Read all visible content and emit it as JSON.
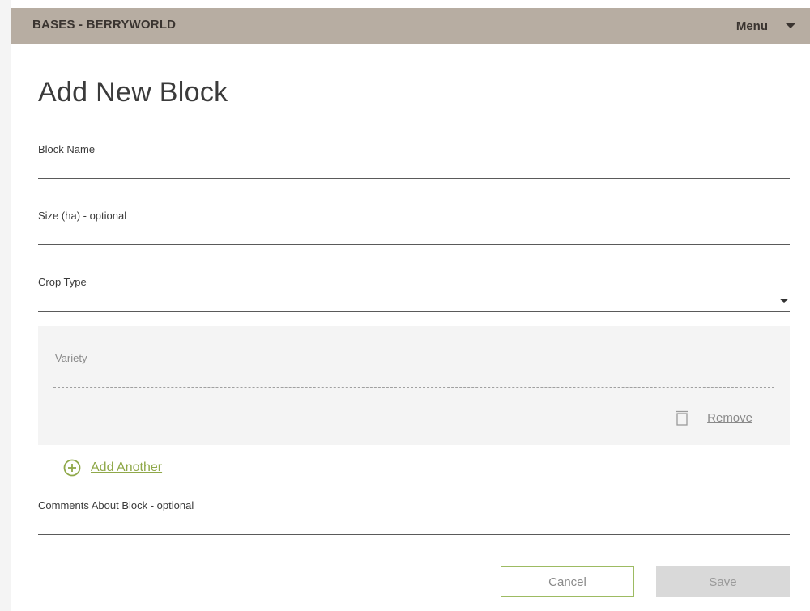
{
  "header": {
    "app_title": "BASES - BERRYWORLD",
    "menu_label": "Menu"
  },
  "page": {
    "title": "Add New Block"
  },
  "form": {
    "block_name": {
      "label": "Block Name",
      "value": ""
    },
    "size": {
      "label": "Size (ha) - optional",
      "value": ""
    },
    "crop_type": {
      "label": "Crop Type",
      "value": ""
    },
    "variety": {
      "label": "Variety",
      "value": "",
      "remove_label": "Remove"
    },
    "add_another_label": "Add Another",
    "comments": {
      "label": "Comments About Block - optional",
      "value": ""
    }
  },
  "actions": {
    "cancel_label": "Cancel",
    "save_label": "Save"
  },
  "icons": {
    "menu": "chevron-down-icon",
    "crop_type": "chevron-down-icon",
    "remove": "trash-icon",
    "add": "plus-circle-icon"
  },
  "colors": {
    "header_bg": "#b7ada2",
    "accent_green": "#8fa849",
    "panel_bg": "#f4f4f4",
    "save_disabled": "#d9d9d9"
  }
}
